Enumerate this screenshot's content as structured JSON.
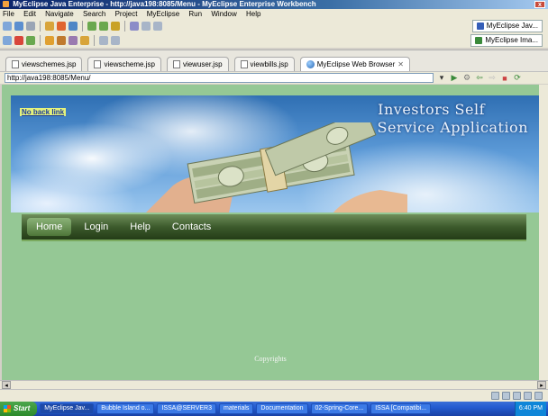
{
  "window": {
    "title": "MyEclipse Java Enterprise - http://java198:8085/Menu - MyEclipse Enterprise Workbench",
    "close_label": "x"
  },
  "menu": [
    "File",
    "Edit",
    "Navigate",
    "Search",
    "Project",
    "MyEclipse",
    "Run",
    "Window",
    "Help"
  ],
  "perspectives": [
    "MyEclipse Jav...",
    "MyEclipse Ima..."
  ],
  "editor_tabs": [
    {
      "label": "viewschemes.jsp",
      "icon": "jsp-file-icon"
    },
    {
      "label": "viewscheme.jsp",
      "icon": "jsp-file-icon"
    },
    {
      "label": "viewuser.jsp",
      "icon": "jsp-file-icon"
    },
    {
      "label": "viewbills.jsp",
      "icon": "jsp-file-icon"
    },
    {
      "label": "MyEclipse Web Browser",
      "icon": "globe-icon",
      "active": true
    }
  ],
  "address": {
    "url": "http://java198:8085/Menu/"
  },
  "page": {
    "back_link": "No back link",
    "headline_line1": "Investors Self",
    "headline_line2": "Service Application",
    "nav": [
      "Home",
      "Login",
      "Help",
      "Contacts"
    ],
    "copyright": "Copyrights"
  },
  "taskbar": {
    "start": "Start",
    "tasks": [
      "MyEclipse Jav...",
      "Bubble Island o...",
      "ISSA@SERVER3",
      "materials",
      "Documentation",
      "02-Spring-Core...",
      "ISSA [Compatibi..."
    ],
    "clock": "6:40 PM"
  },
  "colors": {
    "page_bg": "#95c895",
    "nav_bg": "#3c5a2c",
    "back_link_bg": "#e5f27c"
  }
}
